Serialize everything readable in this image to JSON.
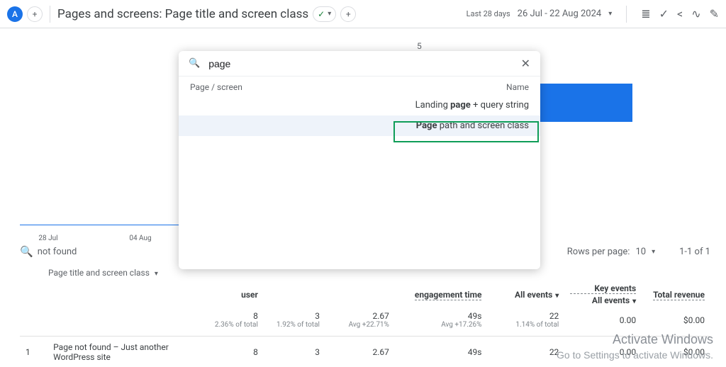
{
  "header": {
    "badge": "A",
    "plus": "+",
    "title": "Pages and screens: Page title and screen class",
    "date_label": "Last 28 days",
    "date_range": "26 Jul - 22 Aug 2024"
  },
  "chart": {
    "center_value": "5",
    "ticks": [
      "28\nJul",
      "04\nAug"
    ]
  },
  "controls": {
    "search_text": "not found",
    "rows_per_page_label": "Rows per page:",
    "rows_per_page_value": "10",
    "page_text": "1-1 of 1",
    "dimension": "Page title and screen class"
  },
  "table": {
    "headers": {
      "user": "user",
      "engagement": "engagement time",
      "event_filter": "All events",
      "key_events": "Key events",
      "key_events_sub": "All events",
      "revenue": "Total\nrevenue"
    },
    "summary": {
      "c1": {
        "v": "8",
        "sub": "2.36% of total"
      },
      "c2": {
        "v": "3",
        "sub": "1.92% of total"
      },
      "c3": {
        "v": "2.67",
        "sub": "Avg +22.71%"
      },
      "c4": {
        "v": "49s",
        "sub": "Avg +17.26%"
      },
      "c5": {
        "v": "22",
        "sub": "1.14% of total"
      },
      "c6": {
        "v": "0.00"
      },
      "c7": {
        "v": "$0.00"
      }
    },
    "rows": [
      {
        "idx": "1",
        "title": "Page not found – Just another WordPress site",
        "c1": "8",
        "c2": "3",
        "c3": "2.67",
        "c4": "49s",
        "c5": "22",
        "c6": "0.00",
        "c7": "$0.00"
      }
    ]
  },
  "modal": {
    "query": "page",
    "col_left": "Page / screen",
    "col_right": "Name",
    "items": [
      {
        "prefix": "Landing ",
        "bold": "page",
        "suffix": " + query string"
      },
      {
        "prefix": "",
        "bold": "Page",
        "suffix": " path and screen class"
      }
    ]
  },
  "watermark": {
    "title": "Activate Windows",
    "sub": "Go to Settings to activate Windows."
  }
}
